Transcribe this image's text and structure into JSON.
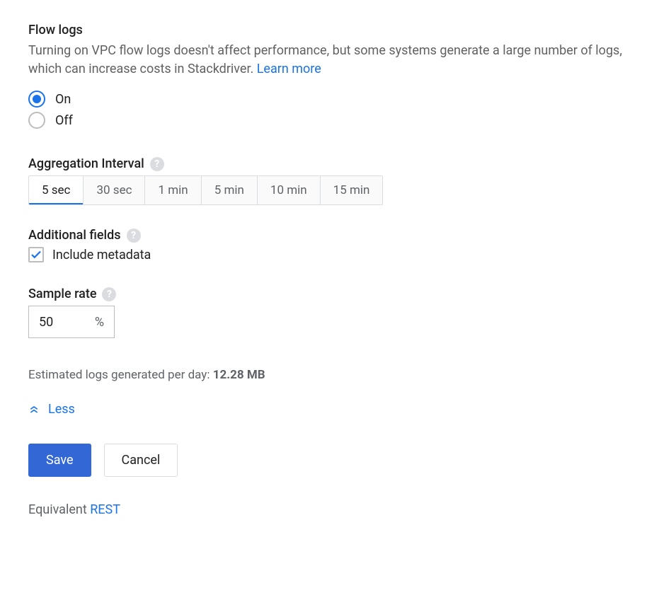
{
  "header": {
    "title": "Flow logs",
    "description": "Turning on VPC flow logs doesn't affect performance, but some systems generate a large number of logs, which can increase costs in Stackdriver. ",
    "learn_more": "Learn more"
  },
  "flow_logs": {
    "options": [
      {
        "label": "On",
        "selected": true
      },
      {
        "label": "Off",
        "selected": false
      }
    ]
  },
  "agg_interval": {
    "label": "Aggregation Interval",
    "options": [
      "5 sec",
      "30 sec",
      "1 min",
      "5 min",
      "10 min",
      "15 min"
    ],
    "selected_index": 0
  },
  "additional_fields": {
    "label": "Additional fields",
    "checkbox_label": "Include metadata",
    "checked": true
  },
  "sample_rate": {
    "label": "Sample rate",
    "value": "50",
    "suffix": "%"
  },
  "estimate": {
    "prefix": "Estimated logs generated per day: ",
    "value": "12.28 MB"
  },
  "toggle": {
    "less_label": "Less"
  },
  "actions": {
    "save": "Save",
    "cancel": "Cancel"
  },
  "footer": {
    "equivalent_prefix": "Equivalent ",
    "rest": "REST"
  }
}
